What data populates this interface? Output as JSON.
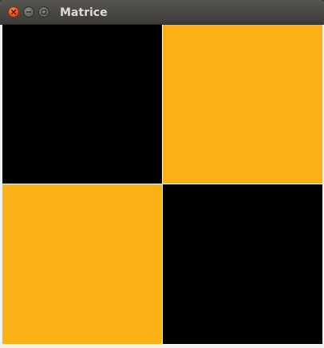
{
  "window": {
    "title": "Matrice",
    "buttons": [
      {
        "name": "close-button",
        "icon": "close-icon"
      },
      {
        "name": "minimize-button",
        "icon": "minimize-icon"
      },
      {
        "name": "maximize-button",
        "icon": "maximize-icon"
      }
    ]
  },
  "colors": {
    "black": "#000000",
    "orange": "#fbb016",
    "grid_line": "#ffffff"
  },
  "matrix": {
    "rows": 2,
    "cols": 2,
    "cells": [
      [
        "black",
        "orange"
      ],
      [
        "orange",
        "black"
      ]
    ]
  }
}
